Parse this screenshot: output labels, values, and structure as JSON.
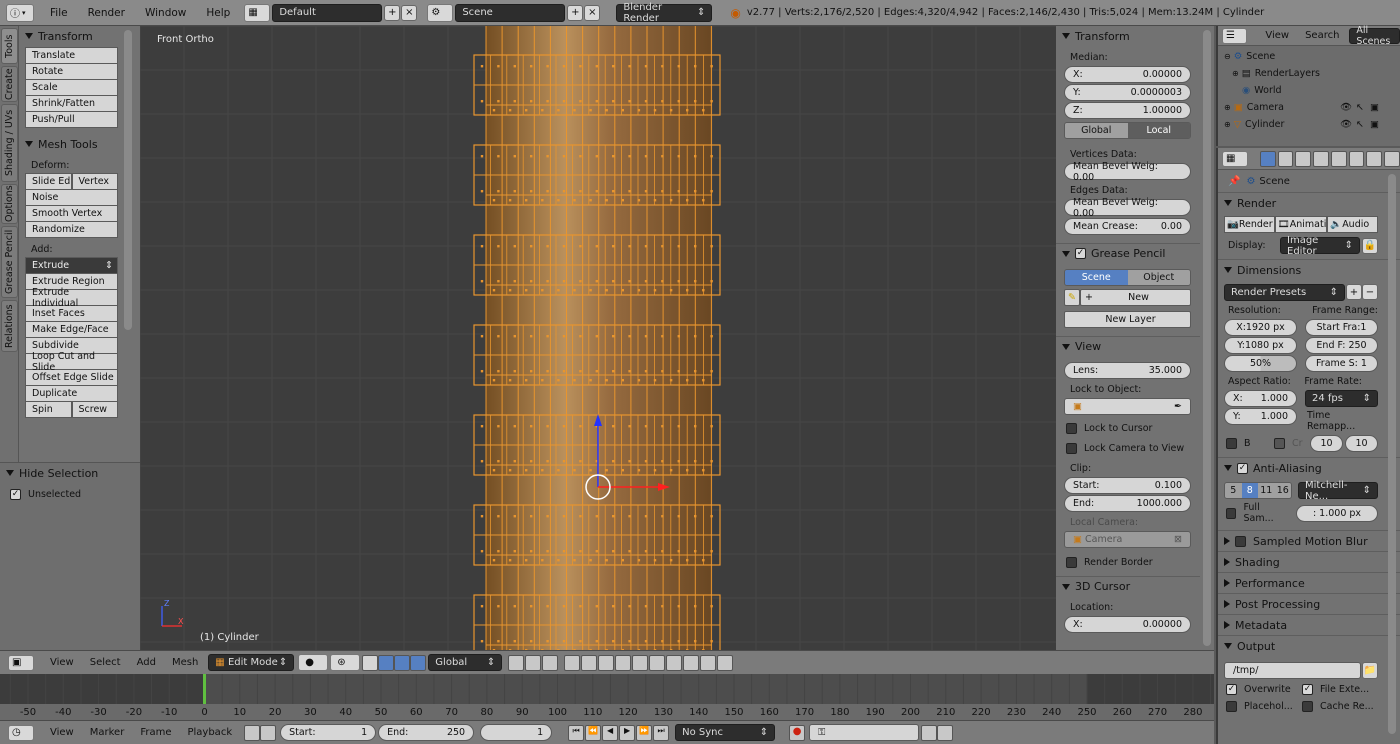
{
  "topbar": {
    "info_icon": "info-icon",
    "menus": [
      "File",
      "Render",
      "Window",
      "Help"
    ],
    "screen_layout": "Default",
    "scene": "Scene",
    "engine": "Blender Render",
    "stats": "v2.77 | Verts:2,176/2,520 | Edges:4,320/4,942 | Faces:2,146/2,430 | Tris:5,024 | Mem:13.24M | Cylinder"
  },
  "vtabs": [
    "Tools",
    "Create",
    "Shading / UVs",
    "Options",
    "Grease Pencil",
    "Relations"
  ],
  "toolshelf": {
    "transform_title": "Transform",
    "transform_buttons": [
      "Translate",
      "Rotate",
      "Scale",
      "Shrink/Fatten",
      "Push/Pull"
    ],
    "mesh_tools_title": "Mesh Tools",
    "deform_label": "Deform:",
    "slide_edge": "Slide Ed",
    "vertex": "Vertex",
    "deform_buttons": [
      "Noise",
      "Smooth Vertex",
      "Randomize"
    ],
    "add_label": "Add:",
    "extrude": "Extrude",
    "add_buttons": [
      "Extrude Region",
      "Extrude Individual",
      "Inset Faces",
      "Make Edge/Face",
      "Subdivide",
      "Loop Cut and Slide",
      "Offset Edge Slide",
      "Duplicate"
    ],
    "spin": "Spin",
    "screw": "Screw",
    "hide_selection_title": "Hide Selection",
    "unselected": "Unselected"
  },
  "viewport": {
    "view_name": "Front Ortho",
    "object_label": "(1) Cylinder",
    "mesh_color": "#e8952e"
  },
  "npanel": {
    "transform_title": "Transform",
    "median_label": "Median:",
    "x_label": "X:",
    "x_value": "0.00000",
    "y_label": "Y:",
    "y_value": "0.0000003",
    "z_label": "Z:",
    "z_value": "1.00000",
    "global": "Global",
    "local": "Local",
    "vertices_data": "Vertices Data:",
    "mean_bevel_weight_v": "Mean Bevel Weig: 0.00",
    "edges_data": "Edges Data:",
    "mean_bevel_weight_e": "Mean Bevel Weig: 0.00",
    "mean_crease_label": "Mean Crease:",
    "mean_crease_value": "0.00",
    "grease_pencil_title": "Grease Pencil",
    "gp_scene": "Scene",
    "gp_object": "Object",
    "gp_new": "New",
    "gp_new_layer": "New Layer",
    "view_title": "View",
    "lens_label": "Lens:",
    "lens_value": "35.000",
    "lock_to_object": "Lock to Object:",
    "lock_to_cursor": "Lock to Cursor",
    "lock_camera_to_view": "Lock Camera to View",
    "clip_label": "Clip:",
    "clip_start_label": "Start:",
    "clip_start_value": "0.100",
    "clip_end_label": "End:",
    "clip_end_value": "1000.000",
    "local_camera": "Local Camera:",
    "camera_field": "Camera",
    "render_border": "Render Border",
    "cursor_title": "3D Cursor",
    "location_label": "Location:",
    "cursor_x_label": "X:",
    "cursor_x_value": "0.00000"
  },
  "outliner": {
    "view": "View",
    "search": "Search",
    "all_scenes": "All Scenes",
    "items": [
      "Scene",
      "RenderLayers",
      "World",
      "Camera",
      "Cylinder"
    ]
  },
  "props": {
    "scene_name": "Scene",
    "render_title": "Render",
    "render_btn": "Render",
    "animation_btn": "Animati",
    "audio_btn": "Audio",
    "display_label": "Display:",
    "display_value": "Image Editor",
    "dimensions_title": "Dimensions",
    "render_presets": "Render Presets",
    "resolution_label": "Resolution:",
    "frame_range_label": "Frame Range:",
    "res_x": "X:1920 px",
    "res_y": "Y:1080 px",
    "res_pct": "50%",
    "start_frame": "Start Fra:1",
    "end_frame": "End F: 250",
    "frame_step": "Frame S: 1",
    "aspect_label": "Aspect Ratio:",
    "frame_rate_label": "Frame Rate:",
    "aspect_x_label": "X:",
    "aspect_x_value": "1.000",
    "aspect_y_label": "Y:",
    "aspect_y_value": "1.000",
    "fps": "24 fps",
    "time_remap": "Time Remapp...",
    "border_b": "B",
    "border_cr": "Cr",
    "remap_old": "10",
    "remap_new": "10",
    "anti_aliasing_title": "Anti-Aliasing",
    "aa_samples": [
      "5",
      "8",
      "11",
      "16"
    ],
    "aa_filter": "Mitchell-Ne...",
    "full_sample": "Full Sam...",
    "filter_size": ": 1.000 px",
    "sampled_motion_blur": "Sampled Motion Blur",
    "shading": "Shading",
    "performance": "Performance",
    "post_processing": "Post Processing",
    "metadata": "Metadata",
    "output_title": "Output",
    "output_path": "/tmp/",
    "overwrite": "Overwrite",
    "file_extensions": "File Exte...",
    "placeholders": "Placehol...",
    "cache_result": "Cache Re..."
  },
  "vp_header": {
    "menus": [
      "View",
      "Select",
      "Add",
      "Mesh"
    ],
    "mode": "Edit Mode",
    "orientation": "Global"
  },
  "timeline": {
    "ticks": [
      "-50",
      "-40",
      "-30",
      "-20",
      "-10",
      "0",
      "10",
      "20",
      "30",
      "40",
      "50",
      "60",
      "70",
      "80",
      "90",
      "100",
      "110",
      "120",
      "130",
      "140",
      "150",
      "160",
      "170",
      "180",
      "190",
      "200",
      "210",
      "220",
      "230",
      "240",
      "250",
      "260",
      "270",
      "280"
    ],
    "current_frame_marker": 0
  },
  "tl_header": {
    "menus": [
      "View",
      "Marker",
      "Frame",
      "Playback"
    ],
    "start_label": "Start:",
    "start_value": "1",
    "end_label": "End:",
    "end_value": "250",
    "current": "1",
    "sync": "No Sync"
  }
}
